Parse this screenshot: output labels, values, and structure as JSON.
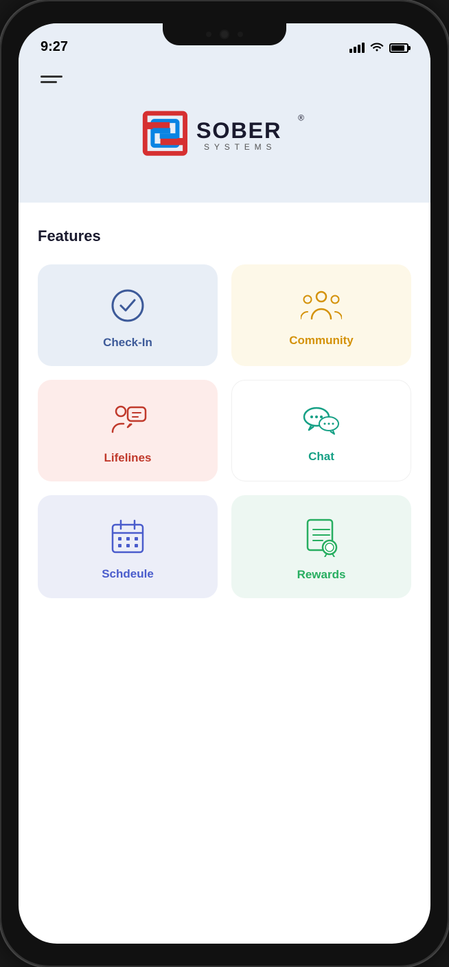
{
  "statusBar": {
    "time": "9:27"
  },
  "header": {
    "appName": "Sober Systems"
  },
  "features": {
    "title": "Features",
    "items": [
      {
        "id": "check-in",
        "label": "Check-In",
        "color": "#3d5a99",
        "bgColor": "#e8eef6"
      },
      {
        "id": "community",
        "label": "Community",
        "color": "#d4920a",
        "bgColor": "#fdf8e8"
      },
      {
        "id": "lifelines",
        "label": "Lifelines",
        "color": "#c0392b",
        "bgColor": "#fdecea"
      },
      {
        "id": "chat",
        "label": "Chat",
        "color": "#16a085",
        "bgColor": "#ffffff"
      },
      {
        "id": "schedule",
        "label": "Schdeule",
        "color": "#4a5ccc",
        "bgColor": "#eceef8"
      },
      {
        "id": "rewards",
        "label": "Rewards",
        "color": "#27ae60",
        "bgColor": "#edf7f2"
      }
    ]
  }
}
